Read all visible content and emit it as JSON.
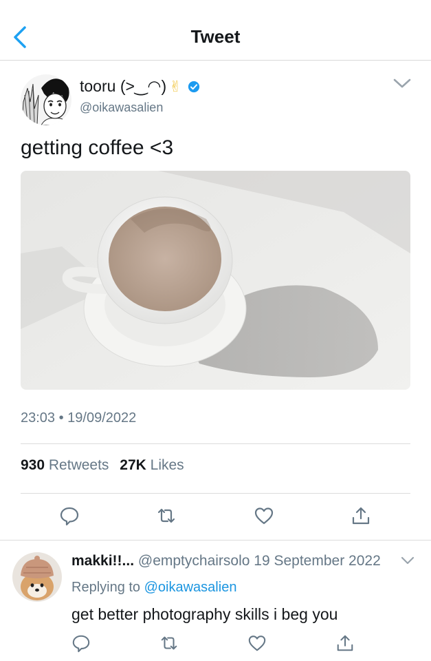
{
  "header": {
    "title": "Tweet",
    "back_icon": "chevron-left-icon",
    "accent": "#1da1f2"
  },
  "tweet": {
    "display_name": "tooru (>‿◠)",
    "name_emoji": "✌",
    "verified": true,
    "handle": "@oikawasalien",
    "text": "getting coffee <3",
    "timestamp": "23:03 • 19/09/2022",
    "retweets_count": "930",
    "retweets_label": "Retweets",
    "likes_count": "27K",
    "likes_label": "Likes",
    "actions": [
      "reply-icon",
      "retweet-icon",
      "like-icon",
      "share-icon"
    ]
  },
  "reply": {
    "display_name": "makki!!...",
    "handle": "@emptychairsolo",
    "date": "19 September 2022",
    "replying_prefix": "Replying to",
    "replying_to": "@oikawasalien",
    "text": "get better photography skills i beg you"
  },
  "colors": {
    "secondary_text": "#657786",
    "mention": "#1b95e0",
    "divider": "#dcdcdc",
    "verified": "#1d9bf0"
  }
}
